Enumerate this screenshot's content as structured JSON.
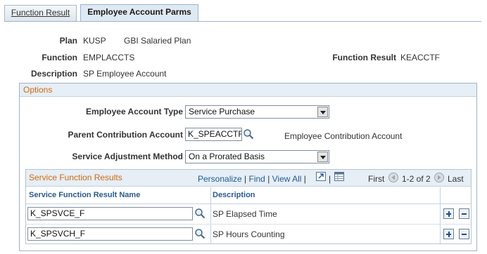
{
  "tabs": [
    {
      "label": "Function Result",
      "active": false
    },
    {
      "label": "Employee Account Parms",
      "active": true
    }
  ],
  "header": {
    "plan_label": "Plan",
    "plan_code": "KUSP",
    "plan_desc": "GBI Salaried Plan",
    "function_label": "Function",
    "function_value": "EMPLACCTS",
    "function_result_label": "Function Result",
    "function_result_value": "KEACCTF",
    "description_label": "Description",
    "description_value": "SP Employee Account"
  },
  "options": {
    "title": "Options",
    "employee_account_type_label": "Employee Account Type",
    "employee_account_type_value": "Service Purchase",
    "parent_contribution_label": "Parent Contribution Account",
    "parent_contribution_value": "K_SPEACCTF",
    "parent_contribution_desc": "Employee Contribution Account",
    "service_adjustment_label": "Service Adjustment Method",
    "service_adjustment_value": "On a Prorated Basis"
  },
  "grid": {
    "title": "Service Function Results",
    "personalize": "Personalize",
    "find": "Find",
    "view_all": "View All",
    "first": "First",
    "range": "1-2 of 2",
    "last": "Last",
    "columns": [
      "Service Function Result Name",
      "Description"
    ],
    "rows": [
      {
        "name": "K_SPSVCE_F",
        "description": "SP Elapsed Time"
      },
      {
        "name": "K_SPSVCH_F",
        "description": "SP Hours Counting"
      }
    ]
  },
  "colors": {
    "accent_orange": "#d06a10",
    "link_blue": "#1f5b96",
    "header_bg": "#e6eef6",
    "border": "#9fb3c8"
  },
  "icons": [
    "lookup-icon",
    "zoom-grid-icon",
    "download-grid-icon",
    "first-arrow-icon",
    "next-arrow-icon",
    "add-row-icon",
    "delete-row-icon"
  ]
}
